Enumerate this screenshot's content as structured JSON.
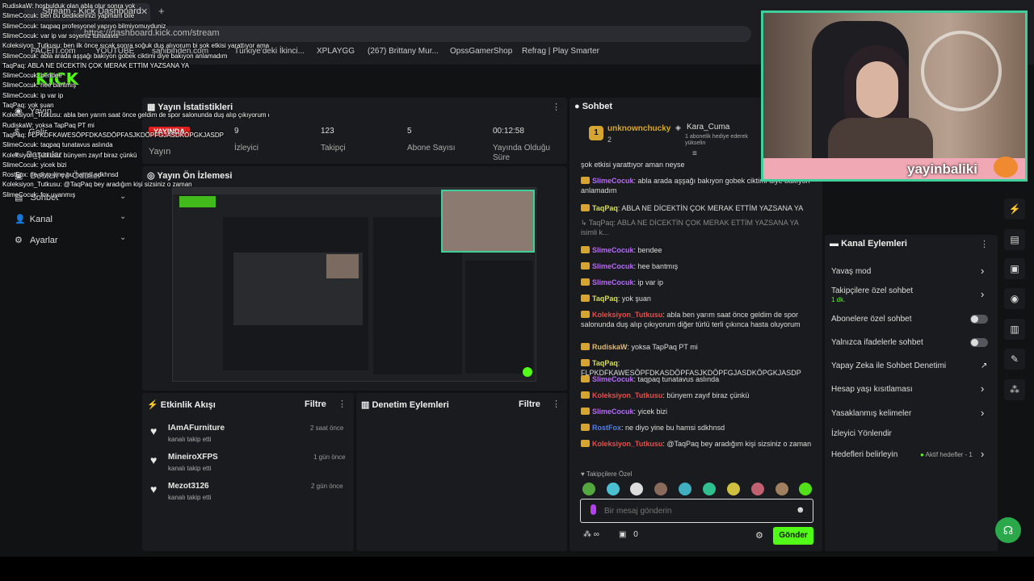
{
  "browser": {
    "tab_title": "Stream - Kick Dashboard",
    "url": "https://dashboard.kick.com/stream",
    "bookmarks": [
      "FACEIT.com",
      "YOUTUBE",
      "sahibinden.com",
      "Türkiye'deki İkinci...",
      "XPLAYGG",
      "(267) Brittany Mur...",
      "OpssGamerShop",
      "Refrag | Play Smarter"
    ]
  },
  "sidebar": {
    "items": [
      {
        "label": "Yayın"
      },
      {
        "label": "Gelir"
      },
      {
        "label": "Başarılar"
      },
      {
        "label": "Destek ve Ödüller"
      },
      {
        "label": "Sohbet"
      },
      {
        "label": "Kanal"
      },
      {
        "label": "Ayarlar"
      }
    ]
  },
  "stats": {
    "title": "Yayın İstatistikleri",
    "live_badge": "YAYINDA",
    "stream_label": "Yayın",
    "items": [
      {
        "value": "9",
        "label": "İzleyici"
      },
      {
        "value": "123",
        "label": "Takipçi"
      },
      {
        "value": "5",
        "label": "Abone Sayısı"
      },
      {
        "value": "00:12:58",
        "label": "Yayında Olduğu Süre"
      }
    ]
  },
  "preview": {
    "title": "Yayın Ön İzlemesi"
  },
  "activity": {
    "title": "Etkinlik Akışı",
    "filter": "Filtre",
    "items": [
      {
        "name": "IAmAFurniture",
        "action": "kanalı takip etti",
        "time": "2 saat önce"
      },
      {
        "name": "MineiroXFPS",
        "action": "kanalı takip etti",
        "time": "1 gün önce"
      },
      {
        "name": "Mezot3126",
        "action": "kanalı takip etti",
        "time": "2 gün önce"
      }
    ]
  },
  "moderation": {
    "title": "Denetim Eylemleri",
    "filter": "Filtre"
  },
  "chat": {
    "title": "Sohbet",
    "top_gifters": [
      {
        "name": "unknownchucky",
        "count": "2"
      },
      {
        "name": "Kara_Cuma",
        "note": "1 abonelik hediye ederek yükselin"
      }
    ],
    "messages": [
      {
        "user": "",
        "text": "şok etkisi yarattıyor aman neyse",
        "color": "#ddd"
      },
      {
        "user": "SlimeCocuk",
        "text": ": abla arada aşşağı bakıyon gobek ciktimi diye bakıyon anlamadım",
        "color": "#b56cf0"
      },
      {
        "user": "TaqPaq",
        "text": ": ABLA NE DİCEKTİN ÇOK MERAK ETTİM YAZSANA YA",
        "color": "#d6e04a"
      },
      {
        "user": "",
        "text": "↳ TaqPaq: ABLA NE DİCEKTİN ÇOK MERAK ETTİM YAZSANA YA isimli k...",
        "color": "#888"
      },
      {
        "user": "SlimeCocuk",
        "text": ": bendee",
        "color": "#b56cf0"
      },
      {
        "user": "SlimeCocuk",
        "text": ": hee bantmış",
        "color": "#b56cf0"
      },
      {
        "user": "SlimeCocuk",
        "text": ": ip var ip",
        "color": "#b56cf0"
      },
      {
        "user": "TaqPaq",
        "text": ": yok şuan",
        "color": "#d6e04a"
      },
      {
        "user": "Koleksiyon_Tutkusu",
        "text": ": abla ben yarım saat önce geldim de spor salonunda duş alıp çıkıyorum diğer türlü terli çıkınca hasta oluyorum",
        "color": "#e05050"
      },
      {
        "user": "RudiskaW",
        "text": ": yoksa TapPaq PT mi",
        "color": "#e0b870"
      },
      {
        "user": "TaqPaq",
        "text": ": FLPKDFKAWESÖPFDKASDÖPFASJKDÖPFGJASDKÖPGKJASDP",
        "color": "#d6e04a"
      },
      {
        "user": "SlimeCocuk",
        "text": ": taqpaq tunatavus aslında",
        "color": "#b56cf0"
      },
      {
        "user": "Koleksiyon_Tutkusu",
        "text": ": bünyem zayıf biraz çünkü",
        "color": "#e05050"
      },
      {
        "user": "SlimeCocuk",
        "text": ": yicek bizi",
        "color": "#b56cf0"
      },
      {
        "user": "RostFox",
        "text": ": ne diyo yine bu hamsi sdkhnsd",
        "color": "#5080e0"
      },
      {
        "user": "Koleksiyon_Tutkusu",
        "text": ": @TaqPaq bey aradığım kişi sizsiniz o zaman",
        "color": "#e05050"
      },
      {
        "user": "SlimeCocuk",
        "text": ": fox uyanmış",
        "color": "#b56cf0"
      }
    ],
    "followers_only": "Takipçilere Özel",
    "placeholder": "Bir mesaj gönderin",
    "points": "0",
    "send": "Gönder"
  },
  "channel_actions": {
    "title": "Kanal Eylemleri",
    "items": [
      {
        "label": "Yavaş mod"
      },
      {
        "label": "Takipçilere özel sohbet",
        "sub": "1 dk."
      },
      {
        "label": "Abonelere özel sohbet"
      },
      {
        "label": "Yalnızca ifadelerle sohbet"
      },
      {
        "label": "Yapay Zeka ile Sohbet Denetimi"
      },
      {
        "label": "Hesap yaşı kısıtlaması"
      },
      {
        "label": "Yasaklanmış kelimeler"
      },
      {
        "label": "İzleyici Yönlendir"
      },
      {
        "label": "Hedefleri belirleyin",
        "sub": "Aktif hedefler - 1"
      }
    ]
  },
  "webcam": {
    "name": "yayinbaliki"
  },
  "overlay": {
    "lines": [
      "RudiskaW: hoşbulduk olan abla olur sonra yok",
      "SlimeCocuk: ben bu dediklerinizi yapmam bile",
      "SlimeCocuk: taqpaq profesyonel yapıyo bilmiyomuyduniz",
      "SlimeCocuk: var ip var soyeniz tunatavis",
      "Koleksiyon_Tutkusu: ben ilk önce sıcak sonra soğuk duş alıyorum bi şok etkisi yarattıyor aman neyse",
      "SlimeCocuk: abla arada aşşağı bakıyon gobek ciktimi diye bakıyon anlamadım",
      "TaqPaq: ABLA NE DİCEKTİN ÇOK MERAK ETTİM YAZSANA YA",
      "SlimeCocuk: bendee",
      "SlimeCocuk: hee bantmış",
      "SlimeCocuk: ip var ip",
      "TaqPaq: yok şuan",
      "Koleksiyon_Tutkusu: abla ben yarım saat önce geldim de spor salonunda duş alıp çıkıyorum diğer türlü terli çıkınca hasta oluyorum",
      "RudiskaW: yoksa TapPaq PT mi",
      "TaqPaq: FLPKDFKAWESÖPFDKASDÖPFASJKDÖPFGJASDKÖPGKJASDP",
      "SlimeCocuk: taqpaq tunatavus aslında",
      "Koleksiyon_Tutkusu: bünyem zayıf biraz çünkü",
      "SlimeCocuk: yicek bizi",
      "RostFox: ne diyo yine bu hamsi sdkhnsd",
      "Koleksiyon_Tutkusu: @TaqPaq bey aradığım kişi sizsiniz o zaman",
      "SlimeCocuk: fox uyanmış"
    ]
  }
}
